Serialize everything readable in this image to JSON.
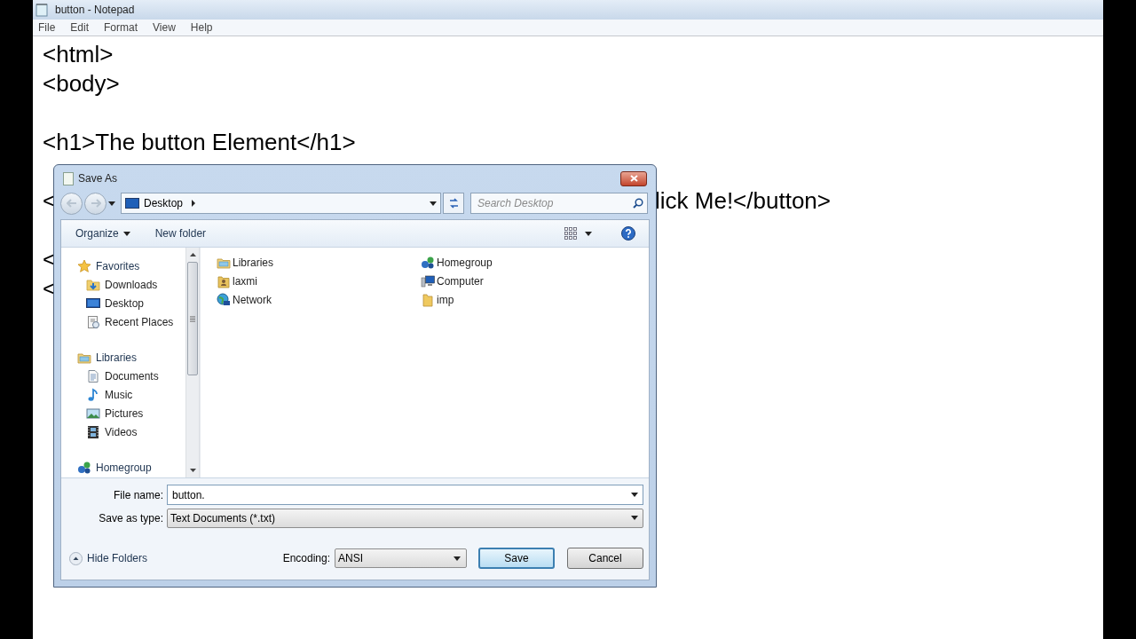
{
  "window": {
    "title": "button - Notepad"
  },
  "menu": [
    "File",
    "Edit",
    "Format",
    "View",
    "Help"
  ],
  "document": {
    "lines": [
      {
        "kind": "text",
        "text": "<html>"
      },
      {
        "kind": "text",
        "text": "<body>"
      },
      {
        "kind": "blank"
      },
      {
        "kind": "text",
        "text": "<h1>The button Element</h1>"
      },
      {
        "kind": "blank"
      },
      {
        "kind": "covered",
        "left": "<",
        "right": "lick Me!</button>"
      },
      {
        "kind": "blank"
      },
      {
        "kind": "covered",
        "left": "<"
      },
      {
        "kind": "covered",
        "left": "<"
      }
    ]
  },
  "dialog": {
    "title": "Save As",
    "address": {
      "location": "Desktop"
    },
    "search": {
      "placeholder": "Search Desktop"
    },
    "toolbar": [
      {
        "label": "Organize",
        "kind": "menu"
      },
      {
        "label": "New folder",
        "kind": "button"
      }
    ],
    "nav": [
      {
        "label": "Favorites",
        "kind": "star",
        "children": [
          {
            "label": "Downloads",
            "kind": "downloads"
          },
          {
            "label": "Desktop",
            "kind": "desktop"
          },
          {
            "label": "Recent Places",
            "kind": "recent"
          }
        ]
      },
      {
        "label": "Libraries",
        "kind": "library",
        "children": [
          {
            "label": "Documents",
            "kind": "document"
          },
          {
            "label": "Music",
            "kind": "music"
          },
          {
            "label": "Pictures",
            "kind": "pictures"
          },
          {
            "label": "Videos",
            "kind": "videos"
          }
        ]
      },
      {
        "label": "Homegroup",
        "kind": "homegroup"
      }
    ],
    "files": [
      {
        "name": "Libraries",
        "kind": "library"
      },
      {
        "name": "laxmi",
        "kind": "user"
      },
      {
        "name": "Network",
        "kind": "network"
      },
      {
        "name": "Homegroup",
        "kind": "homegroup"
      },
      {
        "name": "Computer",
        "kind": "computer"
      },
      {
        "name": "imp",
        "kind": "folder"
      }
    ],
    "file_name": {
      "label": "File name:",
      "value": "button."
    },
    "save_as_type": {
      "label": "Save as type:",
      "value": "Text Documents (*.txt)"
    },
    "hide_folders": "Hide Folders",
    "encoding": {
      "label": "Encoding:",
      "value": "ANSI"
    },
    "buttons": [
      {
        "label": "Save",
        "default": true
      },
      {
        "label": "Cancel",
        "default": false
      }
    ]
  }
}
